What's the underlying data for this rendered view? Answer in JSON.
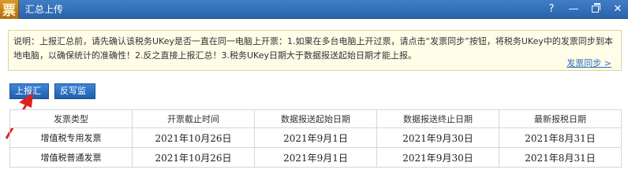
{
  "window": {
    "logo_glyph": "票",
    "title": "汇总上传",
    "controls": {
      "help": "?",
      "minimize": "—",
      "close": "✕"
    }
  },
  "notice": {
    "text": "说明：上报汇总前，请先确认该税务UKey是否一直在同一电脑上开票：1.如果在多台电脑上开过票，请点击“发票同步”按钮，将税务UKey中的发票同步到本地电脑，以确保统计的准确性！2.反之直接上报汇总！3.税务UKey日期大于数据报送起始日期才能上报。",
    "sync_link": "发票同步 >"
  },
  "buttons": {
    "upload": "上报汇总",
    "monitor": "反写监控"
  },
  "table": {
    "headers": [
      "发票类型",
      "开票截止时间",
      "数据报送起始日期",
      "数据报送终止日期",
      "最新报税日期"
    ],
    "rows": [
      [
        "增值税专用发票",
        "2021年10月26日",
        "2021年9月1日",
        "2021年9月30日",
        "2021年8月31日"
      ],
      [
        "增值税普通发票",
        "2021年10月26日",
        "2021年9月1日",
        "2021年9月30日",
        "2021年8月31日"
      ]
    ]
  },
  "colors": {
    "titlebar": "#2f6db5",
    "button": "#2a6fc2",
    "arrow": "#e02020",
    "notice_bg": "#fffde7"
  }
}
